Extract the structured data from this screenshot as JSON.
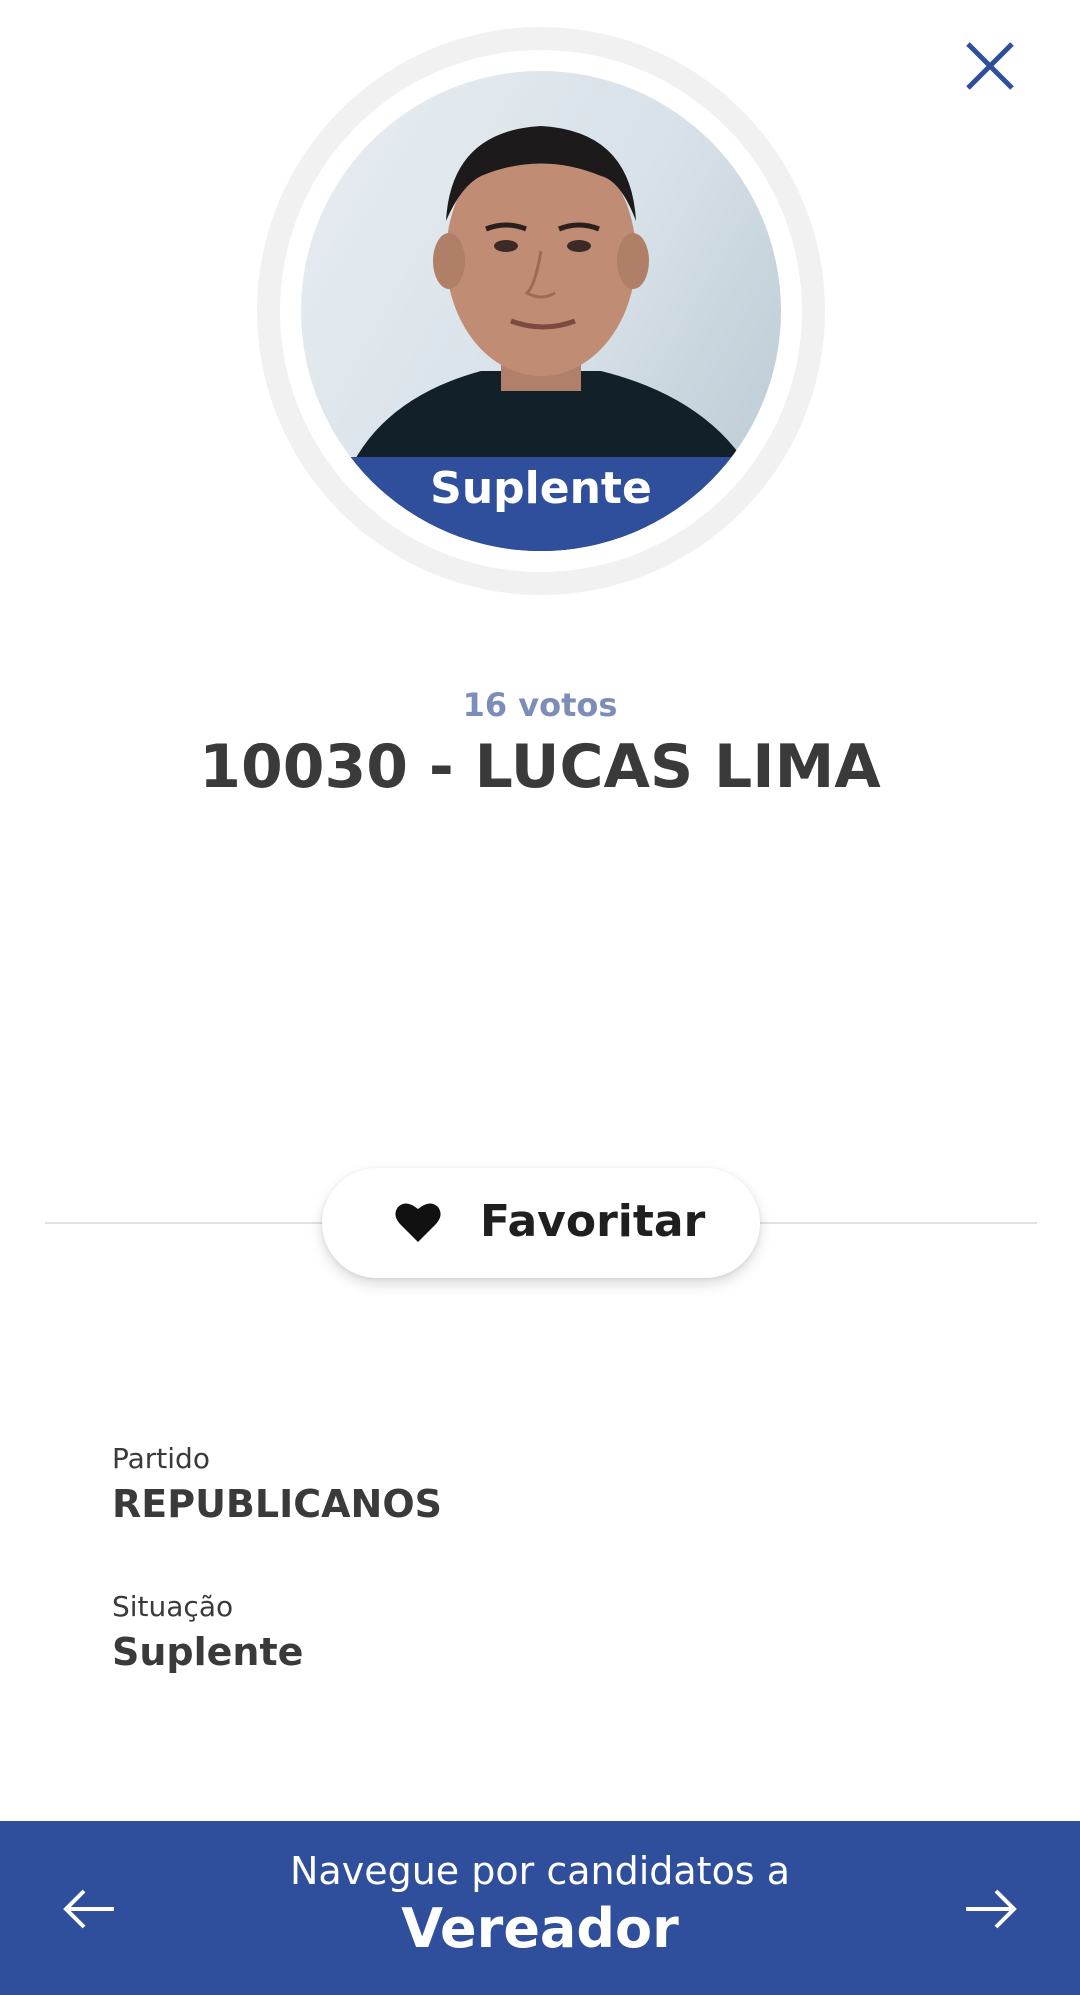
{
  "header": {
    "close_icon": "close-icon"
  },
  "candidate": {
    "status_badge": "Suplente",
    "votes": "16 votos",
    "name": "10030 - LUCAS LIMA"
  },
  "favorite": {
    "label": "Favoritar",
    "icon": "heart-icon"
  },
  "details": {
    "party_label": "Partido",
    "party_value": "REPUBLICANOS",
    "situation_label": "Situação",
    "situation_value": "Suplente"
  },
  "bottom_nav": {
    "subtitle": "Navegue por candidatos a",
    "title": "Vereador",
    "prev_icon": "arrow-left-icon",
    "next_icon": "arrow-right-icon"
  },
  "colors": {
    "brand_blue": "#2f4f9d",
    "votes_text": "#7b8db8",
    "text_dark": "#3a3a3a"
  }
}
